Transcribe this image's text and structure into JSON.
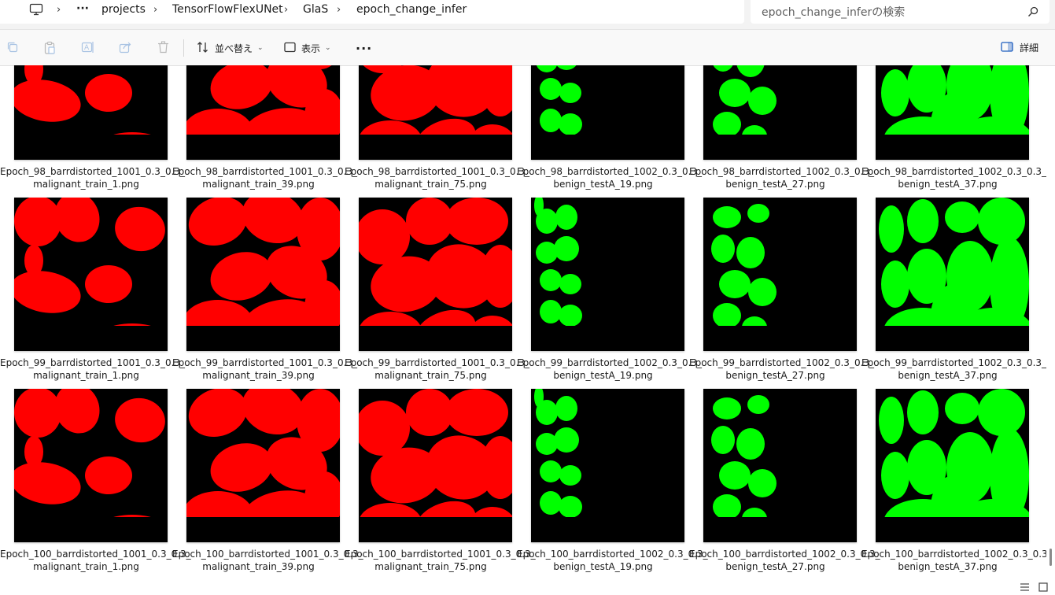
{
  "breadcrumb": {
    "items": [
      "projects",
      "TensorFlowFlexUNet",
      "GlaS",
      "epoch_change_infer"
    ],
    "more": "···"
  },
  "search": {
    "placeholder": "epoch_change_inferの検索"
  },
  "toolbar": {
    "sort_label": "並べ替え",
    "view_label": "表示",
    "more": "···",
    "details_label": "詳細"
  },
  "colors": {
    "malignant": "#ff0000",
    "benign": "#00ff00",
    "background": "#000000"
  },
  "files": [
    {
      "line1": "Epoch_98_barrdistorted_1001_0.3_0.3_",
      "line2": "malignant_train_1.png",
      "class": "malignant"
    },
    {
      "line1": "Epoch_98_barrdistorted_1001_0.3_0.3_",
      "line2": "malignant_train_39.png",
      "class": "malignant"
    },
    {
      "line1": "Epoch_98_barrdistorted_1001_0.3_0.3_",
      "line2": "malignant_train_75.png",
      "class": "malignant"
    },
    {
      "line1": "Epoch_98_barrdistorted_1002_0.3_0.3_",
      "line2": "benign_testA_19.png",
      "class": "benign"
    },
    {
      "line1": "Epoch_98_barrdistorted_1002_0.3_0.3_",
      "line2": "benign_testA_27.png",
      "class": "benign"
    },
    {
      "line1": "Epoch_98_barrdistorted_1002_0.3_0.3_",
      "line2": "benign_testA_37.png",
      "class": "benign"
    },
    {
      "line1": "Epoch_99_barrdistorted_1001_0.3_0.3_",
      "line2": "malignant_train_1.png",
      "class": "malignant"
    },
    {
      "line1": "Epoch_99_barrdistorted_1001_0.3_0.3_",
      "line2": "malignant_train_39.png",
      "class": "malignant"
    },
    {
      "line1": "Epoch_99_barrdistorted_1001_0.3_0.3_",
      "line2": "malignant_train_75.png",
      "class": "malignant"
    },
    {
      "line1": "Epoch_99_barrdistorted_1002_0.3_0.3_",
      "line2": "benign_testA_19.png",
      "class": "benign"
    },
    {
      "line1": "Epoch_99_barrdistorted_1002_0.3_0.3_",
      "line2": "benign_testA_27.png",
      "class": "benign"
    },
    {
      "line1": "Epoch_99_barrdistorted_1002_0.3_0.3_",
      "line2": "benign_testA_37.png",
      "class": "benign"
    },
    {
      "line1": "Epoch_100_barrdistorted_1001_0.3_0.3_",
      "line2": "malignant_train_1.png",
      "class": "malignant"
    },
    {
      "line1": "Epoch_100_barrdistorted_1001_0.3_0.3_",
      "line2": "malignant_train_39.png",
      "class": "malignant"
    },
    {
      "line1": "Epoch_100_barrdistorted_1001_0.3_0.3_",
      "line2": "malignant_train_75.png",
      "class": "malignant"
    },
    {
      "line1": "Epoch_100_barrdistorted_1002_0.3_0.3_",
      "line2": "benign_testA_19.png",
      "class": "benign"
    },
    {
      "line1": "Epoch_100_barrdistorted_1002_0.3_0.3_",
      "line2": "benign_testA_27.png",
      "class": "benign"
    },
    {
      "line1": "Epoch_100_barrdistorted_1002_0.3_0.3_",
      "line2": "benign_testA_37.png",
      "class": "benign"
    }
  ]
}
